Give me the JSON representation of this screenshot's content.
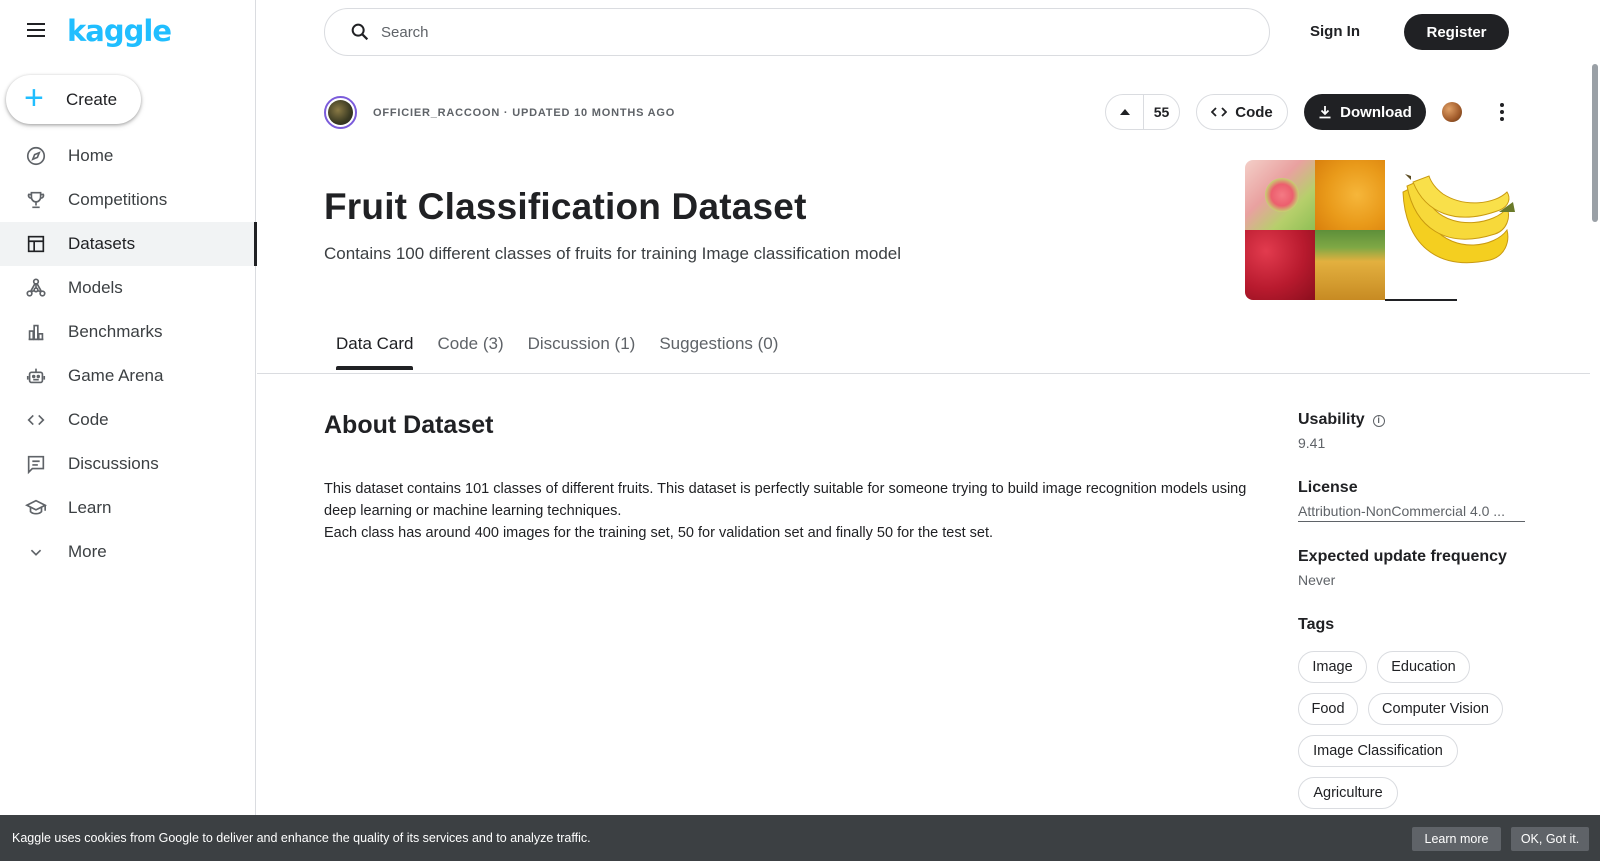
{
  "app": {
    "logo_text": "kaggle",
    "accent_color": "#20beff"
  },
  "sidebar": {
    "create_label": "Create",
    "items": [
      {
        "label": "Home",
        "icon": "compass-icon"
      },
      {
        "label": "Competitions",
        "icon": "trophy-icon"
      },
      {
        "label": "Datasets",
        "icon": "table-icon",
        "active": true
      },
      {
        "label": "Models",
        "icon": "models-icon"
      },
      {
        "label": "Benchmarks",
        "icon": "bar-chart-icon"
      },
      {
        "label": "Game Arena",
        "icon": "robot-icon"
      },
      {
        "label": "Code",
        "icon": "code-icon"
      },
      {
        "label": "Discussions",
        "icon": "comments-icon"
      },
      {
        "label": "Learn",
        "icon": "school-icon"
      },
      {
        "label": "More",
        "icon": "chevron-down-icon"
      }
    ]
  },
  "header": {
    "search_placeholder": "Search",
    "signin_label": "Sign In",
    "register_label": "Register"
  },
  "dataset": {
    "meta": "OFFICIER_RACCOON · UPDATED 10 MONTHS AGO",
    "vote_count": "55",
    "code_label": "Code",
    "download_label": "Download",
    "title": "Fruit Classification Dataset",
    "subtitle": "Contains 100 different classes of fruits for training Image classification model"
  },
  "tabs": [
    {
      "label": "Data Card",
      "active": true
    },
    {
      "label": "Code (3)"
    },
    {
      "label": "Discussion (1)"
    },
    {
      "label": "Suggestions (0)"
    }
  ],
  "about": {
    "heading": "About Dataset",
    "line1": "This dataset contains 101 classes of different fruits. This dataset is perfectly suitable for someone trying to build image recognition models using deep learning or machine learning techniques.",
    "line2": "Each class has around 400 images for the training set, 50 for validation set and finally 50 for the test set."
  },
  "side_panel": {
    "usability_label": "Usability",
    "usability_value": "9.41",
    "license_label": "License",
    "license_value": "Attribution-NonCommercial 4.0 ...",
    "frequency_label": "Expected update frequency",
    "frequency_value": "Never",
    "tags_label": "Tags",
    "tags": [
      "Image",
      "Education",
      "Food",
      "Computer Vision",
      "Image Classification",
      "Agriculture"
    ]
  },
  "cookie": {
    "text": "Kaggle uses cookies from Google to deliver and enhance the quality of its services and to analyze traffic.",
    "learn_more": "Learn more",
    "ok": "OK, Got it."
  }
}
